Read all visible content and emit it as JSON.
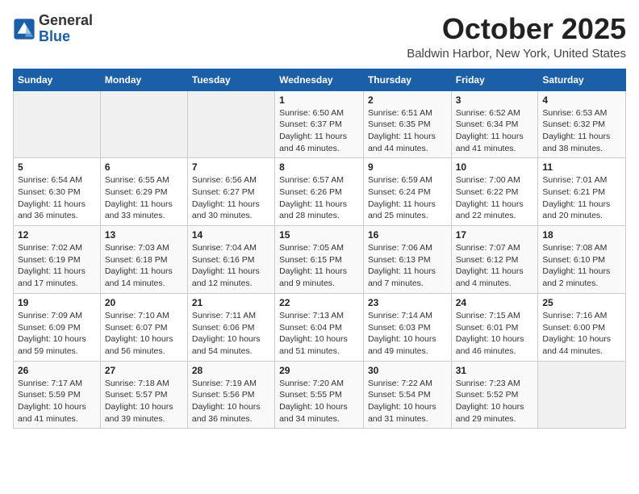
{
  "header": {
    "logo_general": "General",
    "logo_blue": "Blue",
    "month_title": "October 2025",
    "location": "Baldwin Harbor, New York, United States"
  },
  "days_of_week": [
    "Sunday",
    "Monday",
    "Tuesday",
    "Wednesday",
    "Thursday",
    "Friday",
    "Saturday"
  ],
  "weeks": [
    [
      {
        "day": "",
        "info": ""
      },
      {
        "day": "",
        "info": ""
      },
      {
        "day": "",
        "info": ""
      },
      {
        "day": "1",
        "info": "Sunrise: 6:50 AM\nSunset: 6:37 PM\nDaylight: 11 hours and 46 minutes."
      },
      {
        "day": "2",
        "info": "Sunrise: 6:51 AM\nSunset: 6:35 PM\nDaylight: 11 hours and 44 minutes."
      },
      {
        "day": "3",
        "info": "Sunrise: 6:52 AM\nSunset: 6:34 PM\nDaylight: 11 hours and 41 minutes."
      },
      {
        "day": "4",
        "info": "Sunrise: 6:53 AM\nSunset: 6:32 PM\nDaylight: 11 hours and 38 minutes."
      }
    ],
    [
      {
        "day": "5",
        "info": "Sunrise: 6:54 AM\nSunset: 6:30 PM\nDaylight: 11 hours and 36 minutes."
      },
      {
        "day": "6",
        "info": "Sunrise: 6:55 AM\nSunset: 6:29 PM\nDaylight: 11 hours and 33 minutes."
      },
      {
        "day": "7",
        "info": "Sunrise: 6:56 AM\nSunset: 6:27 PM\nDaylight: 11 hours and 30 minutes."
      },
      {
        "day": "8",
        "info": "Sunrise: 6:57 AM\nSunset: 6:26 PM\nDaylight: 11 hours and 28 minutes."
      },
      {
        "day": "9",
        "info": "Sunrise: 6:59 AM\nSunset: 6:24 PM\nDaylight: 11 hours and 25 minutes."
      },
      {
        "day": "10",
        "info": "Sunrise: 7:00 AM\nSunset: 6:22 PM\nDaylight: 11 hours and 22 minutes."
      },
      {
        "day": "11",
        "info": "Sunrise: 7:01 AM\nSunset: 6:21 PM\nDaylight: 11 hours and 20 minutes."
      }
    ],
    [
      {
        "day": "12",
        "info": "Sunrise: 7:02 AM\nSunset: 6:19 PM\nDaylight: 11 hours and 17 minutes."
      },
      {
        "day": "13",
        "info": "Sunrise: 7:03 AM\nSunset: 6:18 PM\nDaylight: 11 hours and 14 minutes."
      },
      {
        "day": "14",
        "info": "Sunrise: 7:04 AM\nSunset: 6:16 PM\nDaylight: 11 hours and 12 minutes."
      },
      {
        "day": "15",
        "info": "Sunrise: 7:05 AM\nSunset: 6:15 PM\nDaylight: 11 hours and 9 minutes."
      },
      {
        "day": "16",
        "info": "Sunrise: 7:06 AM\nSunset: 6:13 PM\nDaylight: 11 hours and 7 minutes."
      },
      {
        "day": "17",
        "info": "Sunrise: 7:07 AM\nSunset: 6:12 PM\nDaylight: 11 hours and 4 minutes."
      },
      {
        "day": "18",
        "info": "Sunrise: 7:08 AM\nSunset: 6:10 PM\nDaylight: 11 hours and 2 minutes."
      }
    ],
    [
      {
        "day": "19",
        "info": "Sunrise: 7:09 AM\nSunset: 6:09 PM\nDaylight: 10 hours and 59 minutes."
      },
      {
        "day": "20",
        "info": "Sunrise: 7:10 AM\nSunset: 6:07 PM\nDaylight: 10 hours and 56 minutes."
      },
      {
        "day": "21",
        "info": "Sunrise: 7:11 AM\nSunset: 6:06 PM\nDaylight: 10 hours and 54 minutes."
      },
      {
        "day": "22",
        "info": "Sunrise: 7:13 AM\nSunset: 6:04 PM\nDaylight: 10 hours and 51 minutes."
      },
      {
        "day": "23",
        "info": "Sunrise: 7:14 AM\nSunset: 6:03 PM\nDaylight: 10 hours and 49 minutes."
      },
      {
        "day": "24",
        "info": "Sunrise: 7:15 AM\nSunset: 6:01 PM\nDaylight: 10 hours and 46 minutes."
      },
      {
        "day": "25",
        "info": "Sunrise: 7:16 AM\nSunset: 6:00 PM\nDaylight: 10 hours and 44 minutes."
      }
    ],
    [
      {
        "day": "26",
        "info": "Sunrise: 7:17 AM\nSunset: 5:59 PM\nDaylight: 10 hours and 41 minutes."
      },
      {
        "day": "27",
        "info": "Sunrise: 7:18 AM\nSunset: 5:57 PM\nDaylight: 10 hours and 39 minutes."
      },
      {
        "day": "28",
        "info": "Sunrise: 7:19 AM\nSunset: 5:56 PM\nDaylight: 10 hours and 36 minutes."
      },
      {
        "day": "29",
        "info": "Sunrise: 7:20 AM\nSunset: 5:55 PM\nDaylight: 10 hours and 34 minutes."
      },
      {
        "day": "30",
        "info": "Sunrise: 7:22 AM\nSunset: 5:54 PM\nDaylight: 10 hours and 31 minutes."
      },
      {
        "day": "31",
        "info": "Sunrise: 7:23 AM\nSunset: 5:52 PM\nDaylight: 10 hours and 29 minutes."
      },
      {
        "day": "",
        "info": ""
      }
    ]
  ]
}
